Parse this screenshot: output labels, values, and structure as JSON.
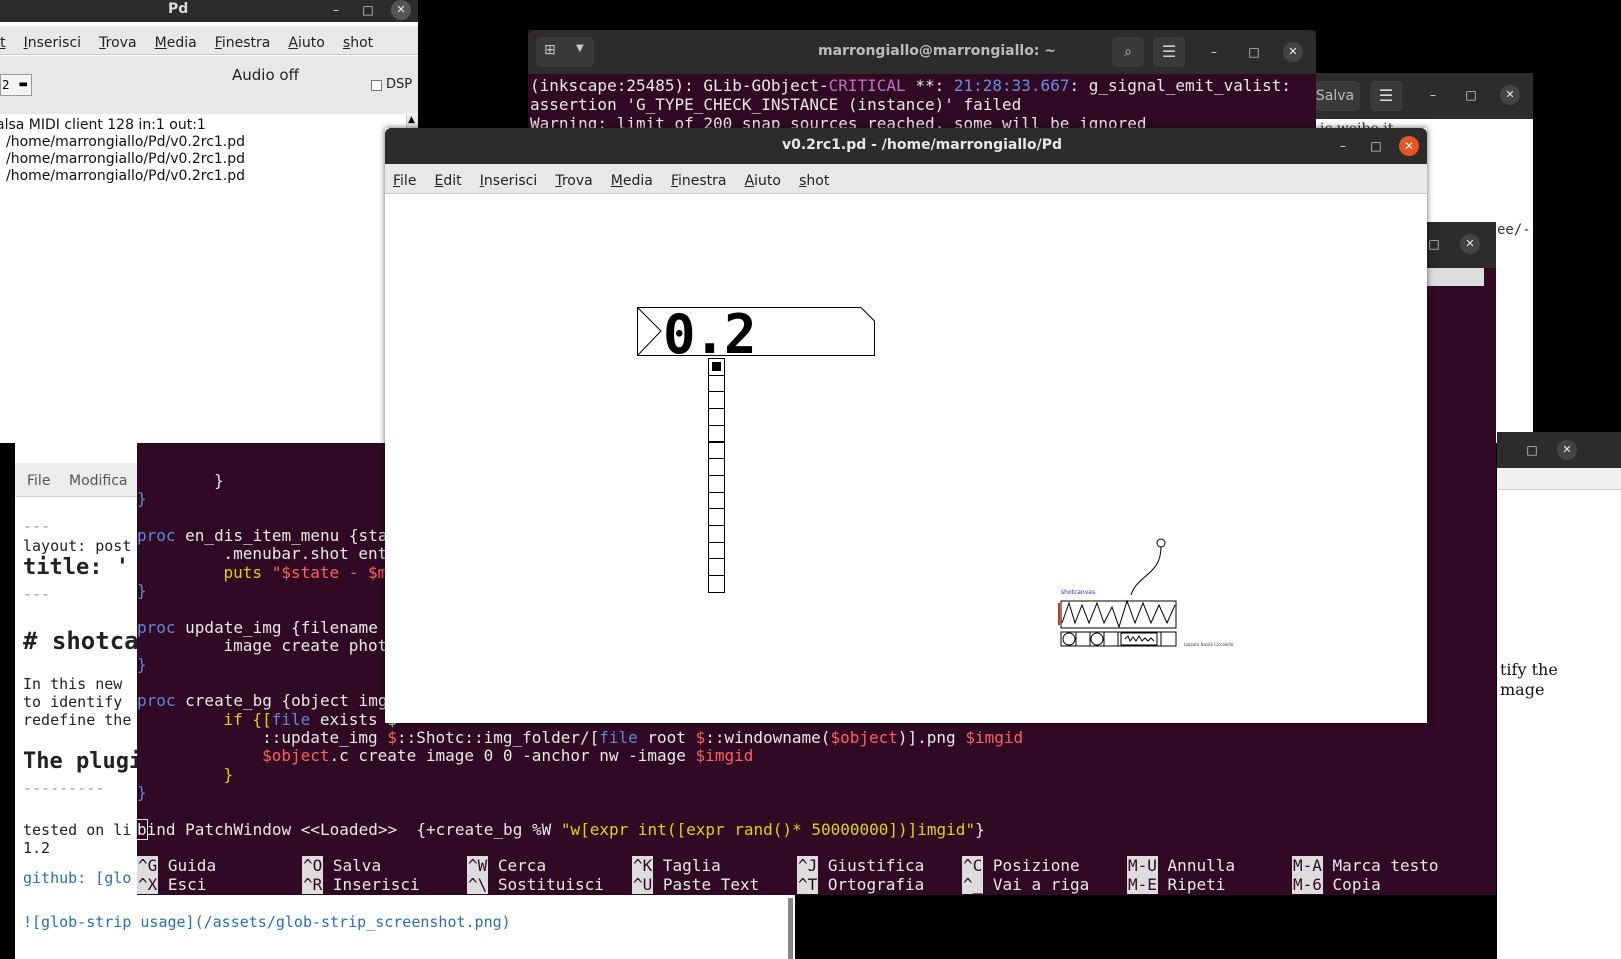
{
  "desktop": {
    "bg": "#000000"
  },
  "pd_main": {
    "title": "Pd",
    "menu": [
      "t",
      "Inserisci",
      "Trova",
      "Media",
      "Finestra",
      "Aiuto",
      "shot"
    ],
    "audio_status": "Audio off",
    "dsp_label": "DSP",
    "level_value": "2",
    "log_lines": [
      "alsa MIDI client 128 in:1 out:1",
      "/home/marrongiallo/Pd/v0.2rc1.pd",
      "/home/marrongiallo/Pd/v0.2rc1.pd",
      "/home/marrongiallo/Pd/v0.2rc1.pd"
    ]
  },
  "terminal": {
    "title": "marrongiallo@marrongiallo: ~",
    "top_lines": {
      "l1_a": "(inkscape:25485): GLib-GObject-",
      "l1_b": "CRITICAL",
      "l1_c": " **: ",
      "l1_d": "21:28:33.667",
      "l1_e": ": g_signal_emit_valist:",
      "l2": "assertion 'G_TYPE_CHECK_INSTANCE (instance)' failed",
      "l3": "Warning: limit of 200 snap sources reached, some will be ignored"
    },
    "bg": "#300a24"
  },
  "gedit": {
    "save_label": "Salva",
    "side_text_1": "ic weibe it",
    "side_text_2": "ee/-",
    "side_text_3": "tify the",
    "side_text_4": "mage"
  },
  "markdown_editor": {
    "menu": [
      "File",
      "Modifica"
    ],
    "lines": {
      "l0": "---",
      "l1": "layout: post",
      "l2": "title:  '",
      "l3": "---",
      "l4": "# shotca",
      "l5": "In this new",
      "l6": "to identify",
      "l7": "redefine the",
      "l8": "The plugi",
      "l9": "---------",
      "l10": "tested on li",
      "l11": "1.2",
      "l12": "github: [glo",
      "l13": "![glob-strip usage](/assets/glob-strip_screenshot.png)"
    }
  },
  "nano": {
    "code": {
      "c1": "        }",
      "c2": "}",
      "c3_kw": "proc",
      "c3_rest": " en_dis_item_menu {sta",
      "c4": "    .menubar.shot entr",
      "c5_cmd": "    puts ",
      "c5_str": "\"$state - $ms",
      "c6": "}",
      "c7_kw": "proc",
      "c7_rest": " update_img {filename",
      "c8": "    image create photo",
      "c9": "}",
      "c10_kw": "proc",
      "c10_rest": " create_bg {object img",
      "c11_kw": "    if {[",
      "c11_file": "file",
      "c11_rest": " exists $",
      "c12_a": "        ::update_img ",
      "c12_b": "$",
      "c12_c": "::Shotc::img_folder/[",
      "c12_d": "file",
      "c12_e": " root ",
      "c12_f": "$",
      "c12_g": "::windowname(",
      "c12_h": "$object",
      "c12_i": ")].png ",
      "c12_j": "$imgid",
      "c13_a": "        ",
      "c13_b": "$object",
      "c13_c": ".c create image 0 0 -anchor nw -image ",
      "c13_d": "$imgid",
      "c14": "    }",
      "c15": "}",
      "c16_a": "b",
      "c16_b": "ind PatchWindow <<Loaded>>  {+create_bg %W ",
      "c16_c": "\"w[expr int([expr rand()* 50000000])]imgid\"",
      "c16_d": "}"
    },
    "shortcuts": [
      {
        "k1": "^G",
        "l1": "Guida",
        "k2": "^X",
        "l2": "Esci"
      },
      {
        "k1": "^O",
        "l1": "Salva",
        "k2": "^R",
        "l2": "Inserisci"
      },
      {
        "k1": "^W",
        "l1": "Cerca",
        "k2": "^\\",
        "l2": "Sostituisci"
      },
      {
        "k1": "^K",
        "l1": "Taglia",
        "k2": "^U",
        "l2": "Paste Text"
      },
      {
        "k1": "^J",
        "l1": "Giustifica",
        "k2": "^T",
        "l2": "Ortografia"
      },
      {
        "k1": "^C",
        "l1": "Posizione",
        "k2": "^_",
        "l2": "Vai a riga"
      },
      {
        "k1": "M-U",
        "l1": "Annulla",
        "k2": "M-E",
        "l2": "Ripeti"
      },
      {
        "k1": "M-A",
        "l1": "Marca testo",
        "k2": "M-6",
        "l2": "Copia"
      }
    ]
  },
  "patch": {
    "title": "v0.2rc1.pd  - /home/marrongiallo/Pd",
    "menu": [
      "File",
      "Edit",
      "Inserisci",
      "Trova",
      "Media",
      "Finestra",
      "Aiuto",
      "shot"
    ],
    "number_value": "0.2",
    "radio_count": 14,
    "thumb_label": "shotcanvas",
    "thumb_credit": "Lazzaro Nicolò Ciccolella"
  }
}
